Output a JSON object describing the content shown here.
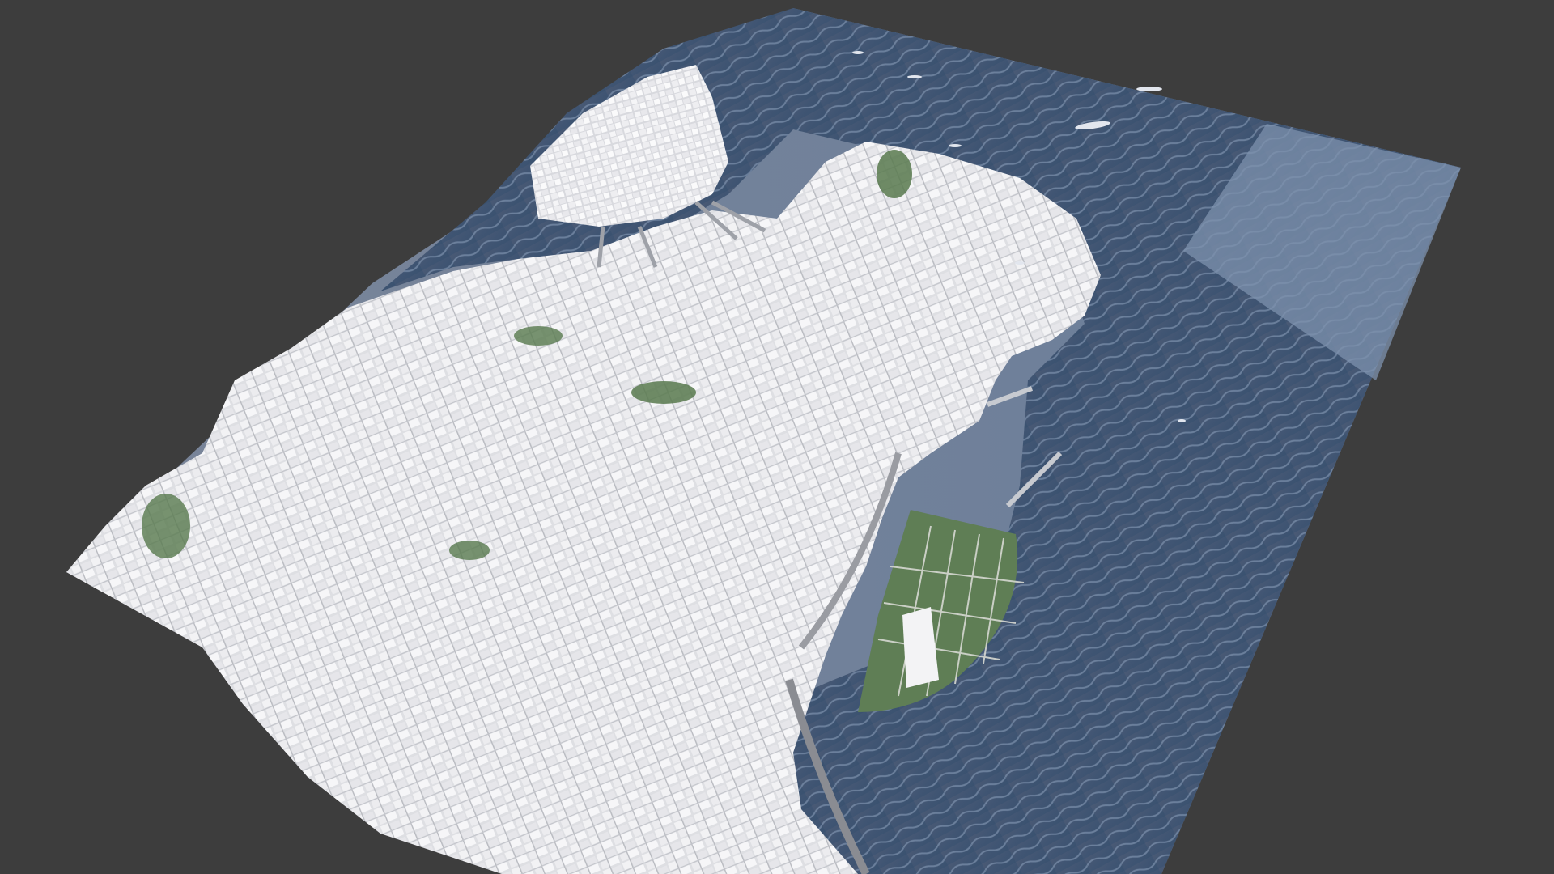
{
  "viewport": {
    "background_color": "#3d3d3d"
  },
  "scene": {
    "subject": "3d-city-model",
    "ground_plane_color": "#6b7b93",
    "water_color": "#415573",
    "building_color": "#e9e9ec",
    "park_color": "#58794e",
    "road_color": "#8a8c92"
  }
}
